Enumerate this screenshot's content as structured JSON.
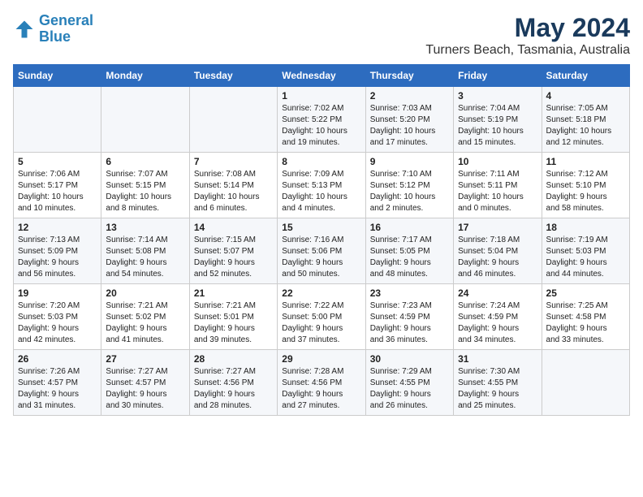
{
  "logo": {
    "line1": "General",
    "line2": "Blue"
  },
  "title": "May 2024",
  "subtitle": "Turners Beach, Tasmania, Australia",
  "days_header": [
    "Sunday",
    "Monday",
    "Tuesday",
    "Wednesday",
    "Thursday",
    "Friday",
    "Saturday"
  ],
  "weeks": [
    [
      {
        "day": "",
        "info": ""
      },
      {
        "day": "",
        "info": ""
      },
      {
        "day": "",
        "info": ""
      },
      {
        "day": "1",
        "info": "Sunrise: 7:02 AM\nSunset: 5:22 PM\nDaylight: 10 hours\nand 19 minutes."
      },
      {
        "day": "2",
        "info": "Sunrise: 7:03 AM\nSunset: 5:20 PM\nDaylight: 10 hours\nand 17 minutes."
      },
      {
        "day": "3",
        "info": "Sunrise: 7:04 AM\nSunset: 5:19 PM\nDaylight: 10 hours\nand 15 minutes."
      },
      {
        "day": "4",
        "info": "Sunrise: 7:05 AM\nSunset: 5:18 PM\nDaylight: 10 hours\nand 12 minutes."
      }
    ],
    [
      {
        "day": "5",
        "info": "Sunrise: 7:06 AM\nSunset: 5:17 PM\nDaylight: 10 hours\nand 10 minutes."
      },
      {
        "day": "6",
        "info": "Sunrise: 7:07 AM\nSunset: 5:15 PM\nDaylight: 10 hours\nand 8 minutes."
      },
      {
        "day": "7",
        "info": "Sunrise: 7:08 AM\nSunset: 5:14 PM\nDaylight: 10 hours\nand 6 minutes."
      },
      {
        "day": "8",
        "info": "Sunrise: 7:09 AM\nSunset: 5:13 PM\nDaylight: 10 hours\nand 4 minutes."
      },
      {
        "day": "9",
        "info": "Sunrise: 7:10 AM\nSunset: 5:12 PM\nDaylight: 10 hours\nand 2 minutes."
      },
      {
        "day": "10",
        "info": "Sunrise: 7:11 AM\nSunset: 5:11 PM\nDaylight: 10 hours\nand 0 minutes."
      },
      {
        "day": "11",
        "info": "Sunrise: 7:12 AM\nSunset: 5:10 PM\nDaylight: 9 hours\nand 58 minutes."
      }
    ],
    [
      {
        "day": "12",
        "info": "Sunrise: 7:13 AM\nSunset: 5:09 PM\nDaylight: 9 hours\nand 56 minutes."
      },
      {
        "day": "13",
        "info": "Sunrise: 7:14 AM\nSunset: 5:08 PM\nDaylight: 9 hours\nand 54 minutes."
      },
      {
        "day": "14",
        "info": "Sunrise: 7:15 AM\nSunset: 5:07 PM\nDaylight: 9 hours\nand 52 minutes."
      },
      {
        "day": "15",
        "info": "Sunrise: 7:16 AM\nSunset: 5:06 PM\nDaylight: 9 hours\nand 50 minutes."
      },
      {
        "day": "16",
        "info": "Sunrise: 7:17 AM\nSunset: 5:05 PM\nDaylight: 9 hours\nand 48 minutes."
      },
      {
        "day": "17",
        "info": "Sunrise: 7:18 AM\nSunset: 5:04 PM\nDaylight: 9 hours\nand 46 minutes."
      },
      {
        "day": "18",
        "info": "Sunrise: 7:19 AM\nSunset: 5:03 PM\nDaylight: 9 hours\nand 44 minutes."
      }
    ],
    [
      {
        "day": "19",
        "info": "Sunrise: 7:20 AM\nSunset: 5:03 PM\nDaylight: 9 hours\nand 42 minutes."
      },
      {
        "day": "20",
        "info": "Sunrise: 7:21 AM\nSunset: 5:02 PM\nDaylight: 9 hours\nand 41 minutes."
      },
      {
        "day": "21",
        "info": "Sunrise: 7:21 AM\nSunset: 5:01 PM\nDaylight: 9 hours\nand 39 minutes."
      },
      {
        "day": "22",
        "info": "Sunrise: 7:22 AM\nSunset: 5:00 PM\nDaylight: 9 hours\nand 37 minutes."
      },
      {
        "day": "23",
        "info": "Sunrise: 7:23 AM\nSunset: 4:59 PM\nDaylight: 9 hours\nand 36 minutes."
      },
      {
        "day": "24",
        "info": "Sunrise: 7:24 AM\nSunset: 4:59 PM\nDaylight: 9 hours\nand 34 minutes."
      },
      {
        "day": "25",
        "info": "Sunrise: 7:25 AM\nSunset: 4:58 PM\nDaylight: 9 hours\nand 33 minutes."
      }
    ],
    [
      {
        "day": "26",
        "info": "Sunrise: 7:26 AM\nSunset: 4:57 PM\nDaylight: 9 hours\nand 31 minutes."
      },
      {
        "day": "27",
        "info": "Sunrise: 7:27 AM\nSunset: 4:57 PM\nDaylight: 9 hours\nand 30 minutes."
      },
      {
        "day": "28",
        "info": "Sunrise: 7:27 AM\nSunset: 4:56 PM\nDaylight: 9 hours\nand 28 minutes."
      },
      {
        "day": "29",
        "info": "Sunrise: 7:28 AM\nSunset: 4:56 PM\nDaylight: 9 hours\nand 27 minutes."
      },
      {
        "day": "30",
        "info": "Sunrise: 7:29 AM\nSunset: 4:55 PM\nDaylight: 9 hours\nand 26 minutes."
      },
      {
        "day": "31",
        "info": "Sunrise: 7:30 AM\nSunset: 4:55 PM\nDaylight: 9 hours\nand 25 minutes."
      },
      {
        "day": "",
        "info": ""
      }
    ]
  ]
}
